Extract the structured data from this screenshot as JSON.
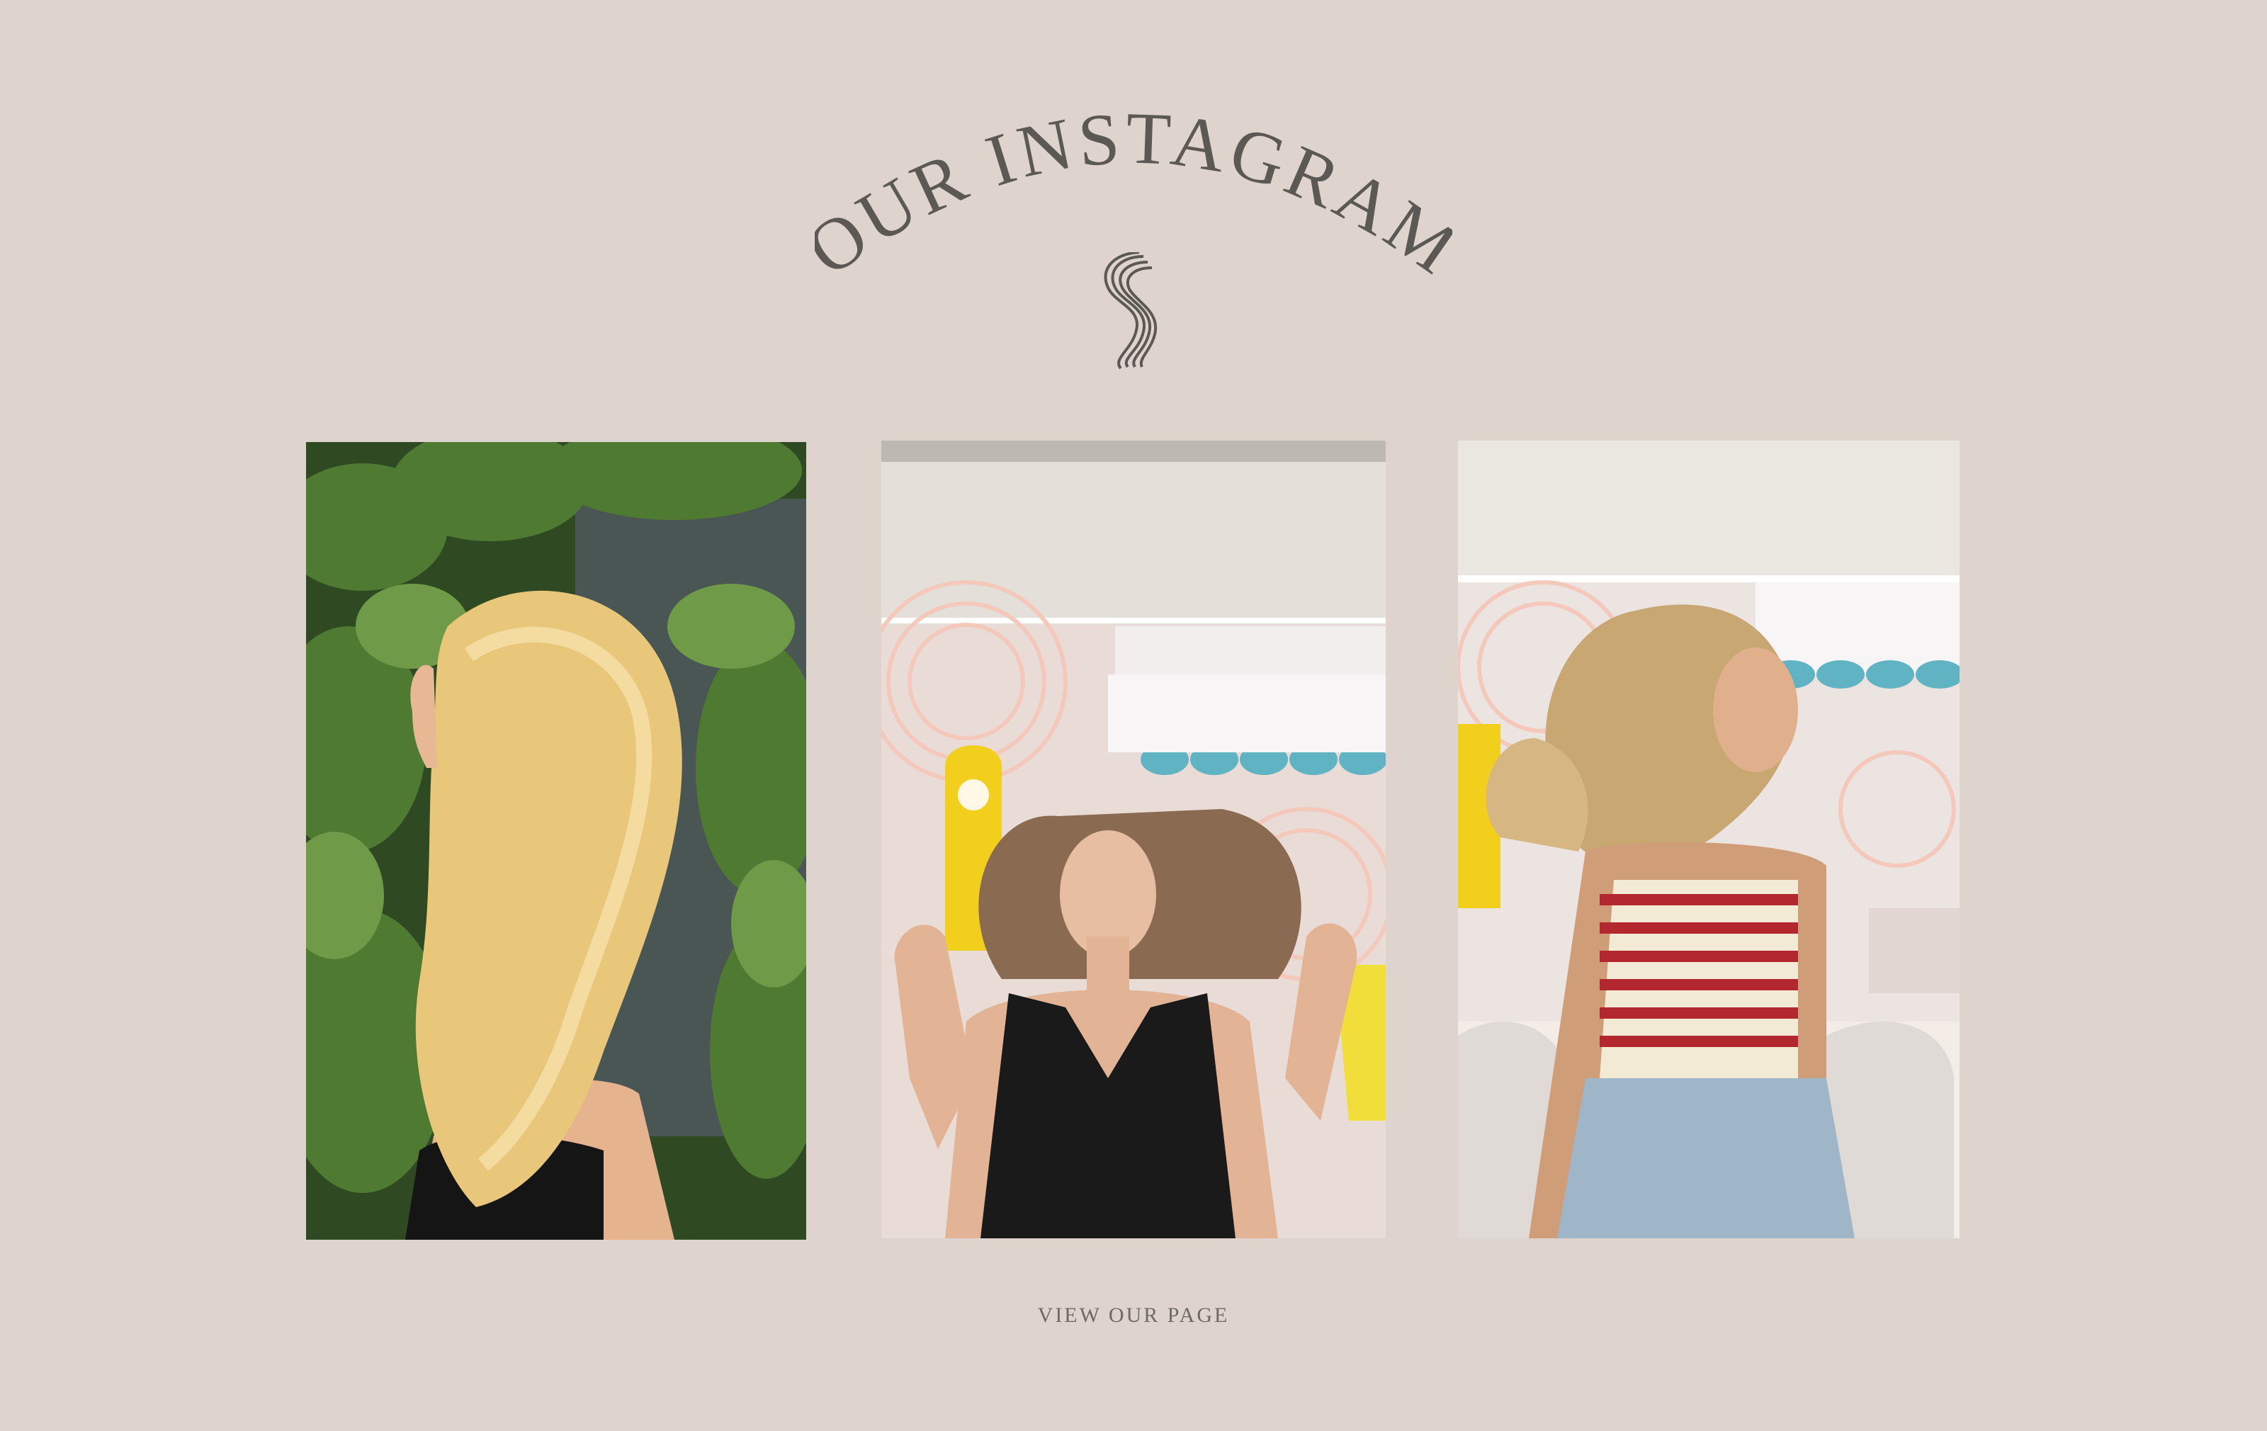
{
  "section": {
    "title": "OUR INSTAGRAM",
    "logo_icon": "wavy-s-logo-icon",
    "link_label": "VIEW OUR PAGE"
  },
  "posts": [
    {
      "icon": "instagram-post-blonde-hair-profile"
    },
    {
      "icon": "instagram-post-hair-flip-salon"
    },
    {
      "icon": "instagram-post-blonde-curls-salon"
    }
  ],
  "colors": {
    "background": "#dfd3cd",
    "title_text": "#5c5954",
    "link_text": "#6d6964"
  }
}
